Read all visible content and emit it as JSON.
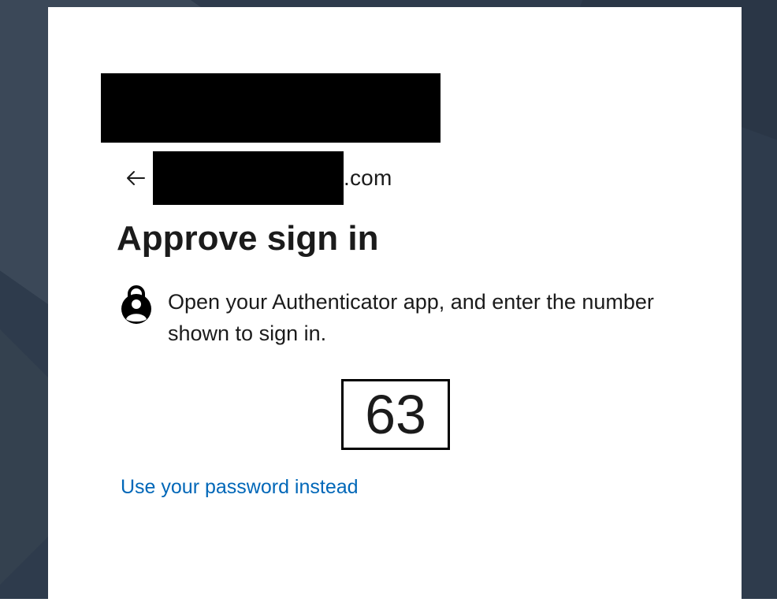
{
  "identity": {
    "back_icon": "arrow-left-icon",
    "email_suffix": ".com"
  },
  "title": "Approve sign in",
  "instruction": {
    "icon": "authenticator-lock-icon",
    "text": "Open your Authenticator app, and enter the number shown to sign in."
  },
  "number_match": "63",
  "alternate_link": "Use your password instead",
  "colors": {
    "background": "#2e3b4c",
    "card": "#ffffff",
    "link": "#0067b8",
    "text": "#1b1b1b"
  }
}
